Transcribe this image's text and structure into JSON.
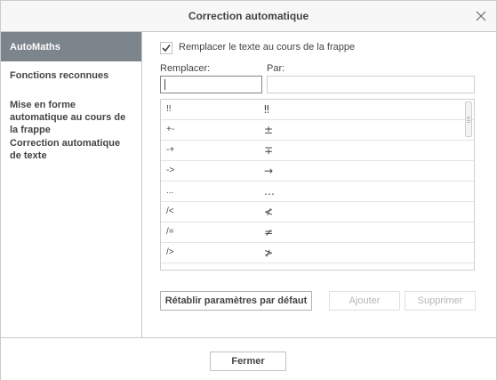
{
  "dialog": {
    "title": "Correction automatique",
    "close_icon": "close-icon"
  },
  "sidebar": {
    "items": [
      {
        "label": "AutoMaths",
        "active": true
      },
      {
        "label": "Fonctions reconnues",
        "active": false
      },
      {
        "label": "Mise en forme automatique au cours de la frappe",
        "active": false
      },
      {
        "label": "Correction automatique de texte",
        "active": false
      }
    ]
  },
  "options": {
    "replace_while_typing_label": "Remplacer le texte au cours de la frappe",
    "replace_while_typing_checked": true
  },
  "fields": {
    "replace_label": "Remplacer:",
    "replace_value": "",
    "by_label": "Par:",
    "by_value": ""
  },
  "table": {
    "rows": [
      {
        "from": "!!",
        "to": "‼"
      },
      {
        "from": "+-",
        "to": "±"
      },
      {
        "from": "-+",
        "to": "∓"
      },
      {
        "from": "->",
        "to": "→"
      },
      {
        "from": "...",
        "to": "…"
      },
      {
        "from": "/<",
        "to": "≮"
      },
      {
        "from": "/=",
        "to": "≠"
      },
      {
        "from": "/>",
        "to": "≯"
      },
      {
        "from": "::",
        "to": "∷"
      }
    ]
  },
  "buttons": {
    "reset_label": "Rétablir paramètres par défaut",
    "add_label": "Ajouter",
    "delete_label": "Supprimer",
    "close_label": "Fermer"
  }
}
